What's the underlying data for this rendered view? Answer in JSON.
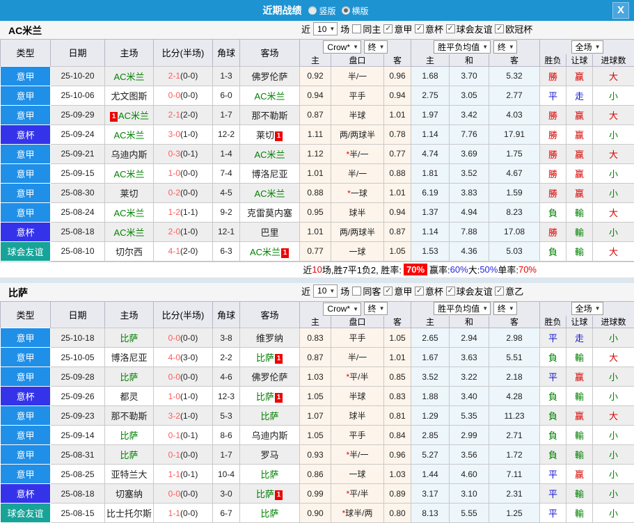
{
  "theme": {
    "titlebar_bg": "#1d93d2",
    "league_serie_a": "#1f8fe8",
    "league_coppa": "#3533ea",
    "league_friendly": "#17a398",
    "win_red": "#d90000",
    "draw_blue": "#1414d0",
    "lose_green": "#008000",
    "score_red": "#ff5a5a",
    "handicap_col_bg": "#fdf5ec",
    "avg_col_bg": "#edf6fb"
  },
  "titlebar": {
    "title": "近期战绩",
    "radio_vertical": "竖版",
    "radio_horizontal": "横版",
    "close": "X"
  },
  "table_header": {
    "type": "类型",
    "date": "日期",
    "home": "主场",
    "score": "比分(半场)",
    "corner": "角球",
    "away": "客场",
    "odds_home": "主",
    "handicap": "盘口",
    "odds_away": "客",
    "avg_home": "主",
    "avg_draw": "和",
    "avg_away": "客",
    "result_wdl": "胜负",
    "result_handicap": "让球",
    "result_goals": "进球数",
    "dd_company": "Crow*",
    "dd_final": "终",
    "dd_avg": "胜平负均值",
    "dd_scope": "全场"
  },
  "sections": [
    {
      "team": "AC米兰",
      "filter": {
        "near": "近",
        "count": "10",
        "games": "场",
        "same": "同主",
        "leagues": [
          "意甲",
          "意杯",
          "球会友谊",
          "欧冠杯"
        ]
      },
      "rows": [
        {
          "lg": "a",
          "type": "意甲",
          "date": "25-10-20",
          "hcard1": "",
          "home": "AC米兰",
          "home_cls": "team-green",
          "hcard2": "",
          "score": "2-1",
          "half": "(0-0)",
          "corner": "1-3",
          "away": "佛罗伦萨",
          "away_cls": "",
          "acard": "",
          "o1": "0.92",
          "star": "",
          "pan": "半/一",
          "o2": "0.96",
          "m1": "1.68",
          "m2": "3.70",
          "m3": "5.32",
          "r1": "勝",
          "r2": "赢",
          "r3": "大"
        },
        {
          "lg": "a",
          "type": "意甲",
          "date": "25-10-06",
          "hcard1": "",
          "home": "尤文图斯",
          "home_cls": "",
          "hcard2": "",
          "score": "0-0",
          "half": "(0-0)",
          "corner": "6-0",
          "away": "AC米兰",
          "away_cls": "team-green",
          "acard": "",
          "o1": "0.94",
          "star": "",
          "pan": "平手",
          "o2": "0.94",
          "m1": "2.75",
          "m2": "3.05",
          "m3": "2.77",
          "r1": "平",
          "r2": "走",
          "r3": "小"
        },
        {
          "lg": "a",
          "type": "意甲",
          "date": "25-09-29",
          "hcard1": "1",
          "home": "AC米兰",
          "home_cls": "team-green",
          "hcard2": "",
          "score": "2-1",
          "half": "(2-0)",
          "corner": "1-7",
          "away": "那不勒斯",
          "away_cls": "",
          "acard": "",
          "o1": "0.87",
          "star": "",
          "pan": "半球",
          "o2": "1.01",
          "m1": "1.97",
          "m2": "3.42",
          "m3": "4.03",
          "r1": "勝",
          "r2": "赢",
          "r3": "大"
        },
        {
          "lg": "c",
          "type": "意杯",
          "date": "25-09-24",
          "hcard1": "",
          "home": "AC米兰",
          "home_cls": "team-green",
          "hcard2": "",
          "score": "3-0",
          "half": "(1-0)",
          "corner": "12-2",
          "away": "莱切",
          "away_cls": "",
          "acard": "1",
          "o1": "1.11",
          "star": "",
          "pan": "两/两球半",
          "o2": "0.78",
          "m1": "1.14",
          "m2": "7.76",
          "m3": "17.91",
          "r1": "勝",
          "r2": "赢",
          "r3": "小"
        },
        {
          "lg": "a",
          "type": "意甲",
          "date": "25-09-21",
          "hcard1": "",
          "home": "乌迪内斯",
          "home_cls": "",
          "hcard2": "",
          "score": "0-3",
          "half": "(0-1)",
          "corner": "1-4",
          "away": "AC米兰",
          "away_cls": "team-green",
          "acard": "",
          "o1": "1.12",
          "star": "*",
          "pan": "半/一",
          "o2": "0.77",
          "m1": "4.74",
          "m2": "3.69",
          "m3": "1.75",
          "r1": "勝",
          "r2": "赢",
          "r3": "大"
        },
        {
          "lg": "a",
          "type": "意甲",
          "date": "25-09-15",
          "hcard1": "",
          "home": "AC米兰",
          "home_cls": "team-green",
          "hcard2": "",
          "score": "1-0",
          "half": "(0-0)",
          "corner": "7-4",
          "away": "博洛尼亚",
          "away_cls": "",
          "acard": "",
          "o1": "1.01",
          "star": "",
          "pan": "半/一",
          "o2": "0.88",
          "m1": "1.81",
          "m2": "3.52",
          "m3": "4.67",
          "r1": "勝",
          "r2": "赢",
          "r3": "小"
        },
        {
          "lg": "a",
          "type": "意甲",
          "date": "25-08-30",
          "hcard1": "",
          "home": "莱切",
          "home_cls": "",
          "hcard2": "",
          "score": "0-2",
          "half": "(0-0)",
          "corner": "4-5",
          "away": "AC米兰",
          "away_cls": "team-green",
          "acard": "",
          "o1": "0.88",
          "star": "*",
          "pan": "一球",
          "o2": "1.01",
          "m1": "6.19",
          "m2": "3.83",
          "m3": "1.59",
          "r1": "勝",
          "r2": "赢",
          "r3": "小"
        },
        {
          "lg": "a",
          "type": "意甲",
          "date": "25-08-24",
          "hcard1": "",
          "home": "AC米兰",
          "home_cls": "team-green",
          "hcard2": "",
          "score": "1-2",
          "half": "(1-1)",
          "corner": "9-2",
          "away": "克雷莫内塞",
          "away_cls": "",
          "acard": "",
          "o1": "0.95",
          "star": "",
          "pan": "球半",
          "o2": "0.94",
          "m1": "1.37",
          "m2": "4.94",
          "m3": "8.23",
          "r1": "負",
          "r2": "輸",
          "r3": "大"
        },
        {
          "lg": "c",
          "type": "意杯",
          "date": "25-08-18",
          "hcard1": "",
          "home": "AC米兰",
          "home_cls": "team-green",
          "hcard2": "",
          "score": "2-0",
          "half": "(1-0)",
          "corner": "12-1",
          "away": "巴里",
          "away_cls": "",
          "acard": "",
          "o1": "1.01",
          "star": "",
          "pan": "两/两球半",
          "o2": "0.87",
          "m1": "1.14",
          "m2": "7.88",
          "m3": "17.08",
          "r1": "勝",
          "r2": "輸",
          "r3": "小"
        },
        {
          "lg": "f",
          "type": "球会友谊",
          "date": "25-08-10",
          "hcard1": "",
          "home": "切尔西",
          "home_cls": "",
          "hcard2": "",
          "score": "4-1",
          "half": "(2-0)",
          "corner": "6-3",
          "away": "AC米兰",
          "away_cls": "team-green",
          "acard": "1",
          "o1": "0.77",
          "star": "",
          "pan": "一球",
          "o2": "1.05",
          "m1": "1.53",
          "m2": "4.36",
          "m3": "5.03",
          "r1": "負",
          "r2": "輸",
          "r3": "大"
        }
      ],
      "summary": {
        "pre": "近",
        "count": "10",
        "mid": "场,胜7平1负2, 胜率:",
        "rate_badge": "70%",
        "win_label": " 赢率:",
        "win_value": "60%",
        "big_label": " 大:",
        "big_value": "50%",
        "single_label": " 单率:",
        "single_value": "70%"
      }
    },
    {
      "team": "比萨",
      "filter": {
        "near": "近",
        "count": "10",
        "games": "场",
        "same": "同客",
        "leagues": [
          "意甲",
          "意杯",
          "球会友谊",
          "意乙"
        ]
      },
      "rows": [
        {
          "lg": "a",
          "type": "意甲",
          "date": "25-10-18",
          "hcard1": "",
          "home": "比萨",
          "home_cls": "team-green",
          "hcard2": "",
          "score": "0-0",
          "half": "(0-0)",
          "corner": "3-8",
          "away": "维罗纳",
          "away_cls": "",
          "acard": "",
          "o1": "0.83",
          "star": "",
          "pan": "平手",
          "o2": "1.05",
          "m1": "2.65",
          "m2": "2.94",
          "m3": "2.98",
          "r1": "平",
          "r2": "走",
          "r3": "小"
        },
        {
          "lg": "a",
          "type": "意甲",
          "date": "25-10-05",
          "hcard1": "",
          "home": "博洛尼亚",
          "home_cls": "",
          "hcard2": "",
          "score": "4-0",
          "half": "(3-0)",
          "corner": "2-2",
          "away": "比萨",
          "away_cls": "team-green",
          "acard": "1",
          "o1": "0.87",
          "star": "",
          "pan": "半/一",
          "o2": "1.01",
          "m1": "1.67",
          "m2": "3.63",
          "m3": "5.51",
          "r1": "負",
          "r2": "輸",
          "r3": "大"
        },
        {
          "lg": "a",
          "type": "意甲",
          "date": "25-09-28",
          "hcard1": "",
          "home": "比萨",
          "home_cls": "team-green",
          "hcard2": "",
          "score": "0-0",
          "half": "(0-0)",
          "corner": "4-6",
          "away": "佛罗伦萨",
          "away_cls": "",
          "acard": "",
          "o1": "1.03",
          "star": "*",
          "pan": "平/半",
          "o2": "0.85",
          "m1": "3.52",
          "m2": "3.22",
          "m3": "2.18",
          "r1": "平",
          "r2": "赢",
          "r3": "小"
        },
        {
          "lg": "c",
          "type": "意杯",
          "date": "25-09-26",
          "hcard1": "",
          "home": "都灵",
          "home_cls": "",
          "hcard2": "",
          "score": "1-0",
          "half": "(1-0)",
          "corner": "12-3",
          "away": "比萨",
          "away_cls": "team-green",
          "acard": "1",
          "o1": "1.05",
          "star": "",
          "pan": "半球",
          "o2": "0.83",
          "m1": "1.88",
          "m2": "3.40",
          "m3": "4.28",
          "r1": "負",
          "r2": "輸",
          "r3": "小"
        },
        {
          "lg": "a",
          "type": "意甲",
          "date": "25-09-23",
          "hcard1": "",
          "home": "那不勒斯",
          "home_cls": "",
          "hcard2": "",
          "score": "3-2",
          "half": "(1-0)",
          "corner": "5-3",
          "away": "比萨",
          "away_cls": "team-green",
          "acard": "",
          "o1": "1.07",
          "star": "",
          "pan": "球半",
          "o2": "0.81",
          "m1": "1.29",
          "m2": "5.35",
          "m3": "11.23",
          "r1": "負",
          "r2": "赢",
          "r3": "大"
        },
        {
          "lg": "a",
          "type": "意甲",
          "date": "25-09-14",
          "hcard1": "",
          "home": "比萨",
          "home_cls": "team-green",
          "hcard2": "",
          "score": "0-1",
          "half": "(0-1)",
          "corner": "8-6",
          "away": "乌迪内斯",
          "away_cls": "",
          "acard": "",
          "o1": "1.05",
          "star": "",
          "pan": "平手",
          "o2": "0.84",
          "m1": "2.85",
          "m2": "2.99",
          "m3": "2.71",
          "r1": "負",
          "r2": "輸",
          "r3": "小"
        },
        {
          "lg": "a",
          "type": "意甲",
          "date": "25-08-31",
          "hcard1": "",
          "home": "比萨",
          "home_cls": "team-green",
          "hcard2": "",
          "score": "0-1",
          "half": "(0-0)",
          "corner": "1-7",
          "away": "罗马",
          "away_cls": "",
          "acard": "",
          "o1": "0.93",
          "star": "*",
          "pan": "半/一",
          "o2": "0.96",
          "m1": "5.27",
          "m2": "3.56",
          "m3": "1.72",
          "r1": "負",
          "r2": "輸",
          "r3": "小"
        },
        {
          "lg": "a",
          "type": "意甲",
          "date": "25-08-25",
          "hcard1": "",
          "home": "亚特兰大",
          "home_cls": "",
          "hcard2": "",
          "score": "1-1",
          "half": "(0-1)",
          "corner": "10-4",
          "away": "比萨",
          "away_cls": "team-green",
          "acard": "",
          "o1": "0.86",
          "star": "",
          "pan": "一球",
          "o2": "1.03",
          "m1": "1.44",
          "m2": "4.60",
          "m3": "7.11",
          "r1": "平",
          "r2": "赢",
          "r3": "小"
        },
        {
          "lg": "c",
          "type": "意杯",
          "date": "25-08-18",
          "hcard1": "",
          "home": "切塞纳",
          "home_cls": "",
          "hcard2": "",
          "score": "0-0",
          "half": "(0-0)",
          "corner": "3-0",
          "away": "比萨",
          "away_cls": "team-green",
          "acard": "1",
          "o1": "0.99",
          "star": "*",
          "pan": "平/半",
          "o2": "0.89",
          "m1": "3.17",
          "m2": "3.10",
          "m3": "2.31",
          "r1": "平",
          "r2": "輸",
          "r3": "小"
        },
        {
          "lg": "f",
          "type": "球会友谊",
          "date": "25-08-15",
          "hcard1": "",
          "home": "比士托尔斯",
          "home_cls": "",
          "hcard2": "",
          "score": "1-1",
          "half": "(0-0)",
          "corner": "6-7",
          "away": "比萨",
          "away_cls": "team-green",
          "acard": "",
          "o1": "0.90",
          "star": "*",
          "pan": "球半/两",
          "o2": "0.80",
          "m1": "8.13",
          "m2": "5.55",
          "m3": "1.25",
          "r1": "平",
          "r2": "輸",
          "r3": "小"
        }
      ]
    }
  ]
}
